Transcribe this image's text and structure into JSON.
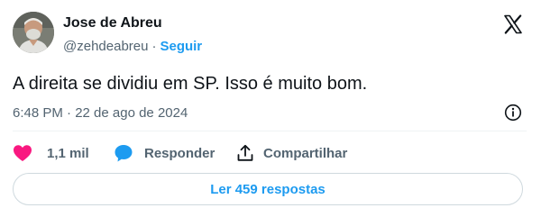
{
  "author": {
    "name": "Jose de Abreu",
    "handle": "@zehdeabreu",
    "separator": "·",
    "follow_label": "Seguir"
  },
  "tweet": {
    "text": "A direita se dividiu em SP. Isso é muito bom.",
    "timestamp": "6:48 PM · 22 de ago de 2024"
  },
  "actions": {
    "likes": "1,1 mil",
    "reply_label": "Responder",
    "share_label": "Compartilhar"
  },
  "replies_button_label": "Ler 459 respostas",
  "icons": {
    "brand": "x-logo-icon",
    "info": "info-icon",
    "like": "heart-icon",
    "reply": "speech-bubble-icon",
    "share": "share-upload-icon"
  },
  "colors": {
    "accent": "#1d9bf0",
    "like": "#f91880",
    "secondary_text": "#536471",
    "primary_text": "#0f1419"
  }
}
